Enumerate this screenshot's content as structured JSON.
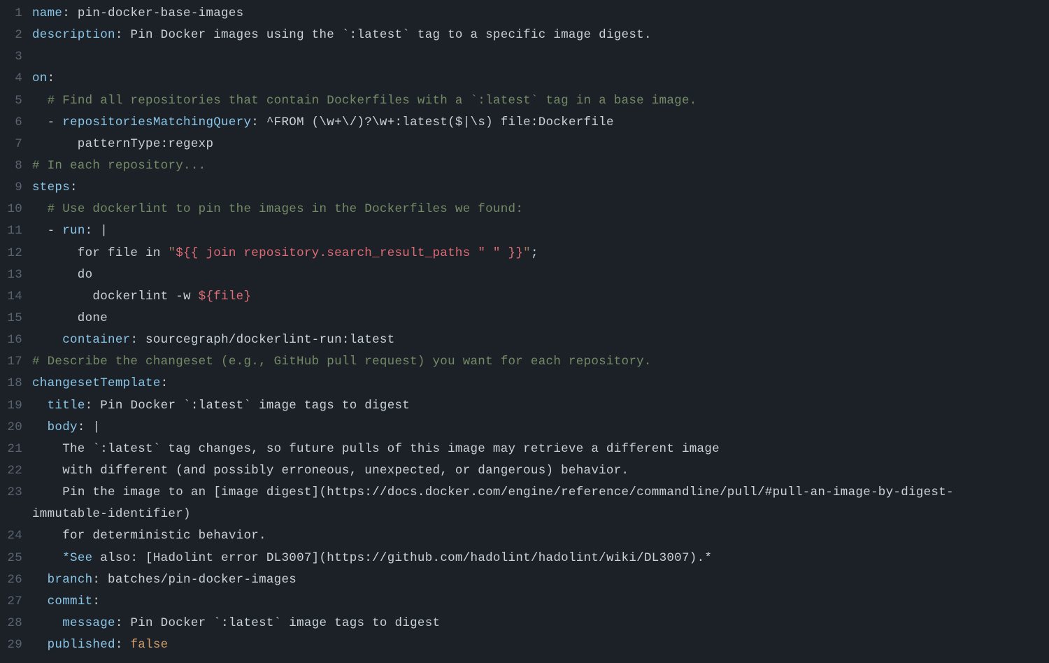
{
  "lines": [
    {
      "n": "1",
      "tokens": [
        {
          "t": "name",
          "c": "tok-key"
        },
        {
          "t": ": ",
          "c": "tok-punc"
        },
        {
          "t": "pin-docker-base-images",
          "c": "tok-str"
        }
      ]
    },
    {
      "n": "2",
      "tokens": [
        {
          "t": "description",
          "c": "tok-key"
        },
        {
          "t": ": ",
          "c": "tok-punc"
        },
        {
          "t": "Pin Docker images using the `:latest` tag to a specific image digest.",
          "c": "tok-str"
        }
      ]
    },
    {
      "n": "3",
      "tokens": []
    },
    {
      "n": "4",
      "tokens": [
        {
          "t": "on",
          "c": "tok-key"
        },
        {
          "t": ":",
          "c": "tok-punc"
        }
      ]
    },
    {
      "n": "5",
      "tokens": [
        {
          "t": "  ",
          "c": ""
        },
        {
          "t": "# Find all repositories that contain Dockerfiles with a `:latest` tag in a base image.",
          "c": "tok-comment"
        }
      ]
    },
    {
      "n": "6",
      "tokens": [
        {
          "t": "  ",
          "c": ""
        },
        {
          "t": "- ",
          "c": "tok-dash"
        },
        {
          "t": "repositoriesMatchingQuery",
          "c": "tok-key"
        },
        {
          "t": ": ",
          "c": "tok-punc"
        },
        {
          "t": "^FROM (\\w+\\/)?\\w+:latest($|\\s) file:Dockerfile",
          "c": "tok-str"
        }
      ]
    },
    {
      "n": "7",
      "tokens": [
        {
          "t": "      patternType:regexp",
          "c": "tok-str"
        }
      ]
    },
    {
      "n": "8",
      "tokens": [
        {
          "t": "# In each repository...",
          "c": "tok-comment"
        }
      ]
    },
    {
      "n": "9",
      "tokens": [
        {
          "t": "steps",
          "c": "tok-key"
        },
        {
          "t": ":",
          "c": "tok-punc"
        }
      ]
    },
    {
      "n": "10",
      "tokens": [
        {
          "t": "  ",
          "c": ""
        },
        {
          "t": "# Use dockerlint to pin the images in the Dockerfiles we found:",
          "c": "tok-comment"
        }
      ]
    },
    {
      "n": "11",
      "tokens": [
        {
          "t": "  ",
          "c": ""
        },
        {
          "t": "- ",
          "c": "tok-dash"
        },
        {
          "t": "run",
          "c": "tok-key"
        },
        {
          "t": ": ",
          "c": "tok-punc"
        },
        {
          "t": "|",
          "c": "tok-pipe"
        }
      ]
    },
    {
      "n": "12",
      "tokens": [
        {
          "t": "      for file in ",
          "c": "tok-str"
        },
        {
          "t": "\"",
          "c": "tok-strhl"
        },
        {
          "t": "${{ join repository.search_result_paths \" \" }}",
          "c": "tok-interp"
        },
        {
          "t": "\"",
          "c": "tok-strhl"
        },
        {
          "t": ";",
          "c": "tok-str"
        }
      ]
    },
    {
      "n": "13",
      "tokens": [
        {
          "t": "      do",
          "c": "tok-str"
        }
      ]
    },
    {
      "n": "14",
      "tokens": [
        {
          "t": "        dockerlint -w ",
          "c": "tok-str"
        },
        {
          "t": "${file}",
          "c": "tok-interp"
        }
      ]
    },
    {
      "n": "15",
      "tokens": [
        {
          "t": "      done",
          "c": "tok-str"
        }
      ]
    },
    {
      "n": "16",
      "tokens": [
        {
          "t": "    ",
          "c": ""
        },
        {
          "t": "container",
          "c": "tok-key"
        },
        {
          "t": ": ",
          "c": "tok-punc"
        },
        {
          "t": "sourcegraph/dockerlint-run:latest",
          "c": "tok-str"
        }
      ]
    },
    {
      "n": "17",
      "tokens": [
        {
          "t": "# Describe the changeset (e.g., GitHub pull request) you want for each repository.",
          "c": "tok-comment"
        }
      ]
    },
    {
      "n": "18",
      "tokens": [
        {
          "t": "changesetTemplate",
          "c": "tok-key"
        },
        {
          "t": ":",
          "c": "tok-punc"
        }
      ]
    },
    {
      "n": "19",
      "tokens": [
        {
          "t": "  ",
          "c": ""
        },
        {
          "t": "title",
          "c": "tok-key"
        },
        {
          "t": ": ",
          "c": "tok-punc"
        },
        {
          "t": "Pin Docker `:latest` image tags to digest",
          "c": "tok-str"
        }
      ]
    },
    {
      "n": "20",
      "tokens": [
        {
          "t": "  ",
          "c": ""
        },
        {
          "t": "body",
          "c": "tok-key"
        },
        {
          "t": ": ",
          "c": "tok-punc"
        },
        {
          "t": "|",
          "c": "tok-pipe"
        }
      ]
    },
    {
      "n": "21",
      "tokens": [
        {
          "t": "    The `:latest` tag changes, so future pulls of this image may retrieve a different image",
          "c": "tok-str"
        }
      ]
    },
    {
      "n": "22",
      "tokens": [
        {
          "t": "    with different (and possibly erroneous, unexpected, or dangerous) behavior.",
          "c": "tok-str"
        }
      ]
    },
    {
      "n": "23",
      "wrap": true,
      "tokens": [
        {
          "t": "    Pin the image to an [image digest](https://docs.docker.com/engine/reference/commandline/pull/#pull-an-image-by-digest-immutable-identifier)",
          "c": "tok-str"
        }
      ]
    },
    {
      "n": "24",
      "tokens": [
        {
          "t": "    for deterministic behavior.",
          "c": "tok-str"
        }
      ]
    },
    {
      "n": "25",
      "tokens": [
        {
          "t": "    ",
          "c": ""
        },
        {
          "t": "*See",
          "c": "tok-key"
        },
        {
          "t": " also: [Hadolint error DL3007](https://github.com/hadolint/hadolint/wiki/DL3007).*",
          "c": "tok-str"
        }
      ]
    },
    {
      "n": "26",
      "tokens": [
        {
          "t": "  ",
          "c": ""
        },
        {
          "t": "branch",
          "c": "tok-key"
        },
        {
          "t": ": ",
          "c": "tok-punc"
        },
        {
          "t": "batches/pin-docker-images",
          "c": "tok-str"
        }
      ]
    },
    {
      "n": "27",
      "tokens": [
        {
          "t": "  ",
          "c": ""
        },
        {
          "t": "commit",
          "c": "tok-key"
        },
        {
          "t": ":",
          "c": "tok-punc"
        }
      ]
    },
    {
      "n": "28",
      "tokens": [
        {
          "t": "    ",
          "c": ""
        },
        {
          "t": "message",
          "c": "tok-key"
        },
        {
          "t": ": ",
          "c": "tok-punc"
        },
        {
          "t": "Pin Docker `:latest` image tags to digest",
          "c": "tok-str"
        }
      ]
    },
    {
      "n": "29",
      "tokens": [
        {
          "t": "  ",
          "c": ""
        },
        {
          "t": "published",
          "c": "tok-key"
        },
        {
          "t": ": ",
          "c": "tok-punc"
        },
        {
          "t": "false",
          "c": "tok-bool"
        }
      ]
    }
  ]
}
